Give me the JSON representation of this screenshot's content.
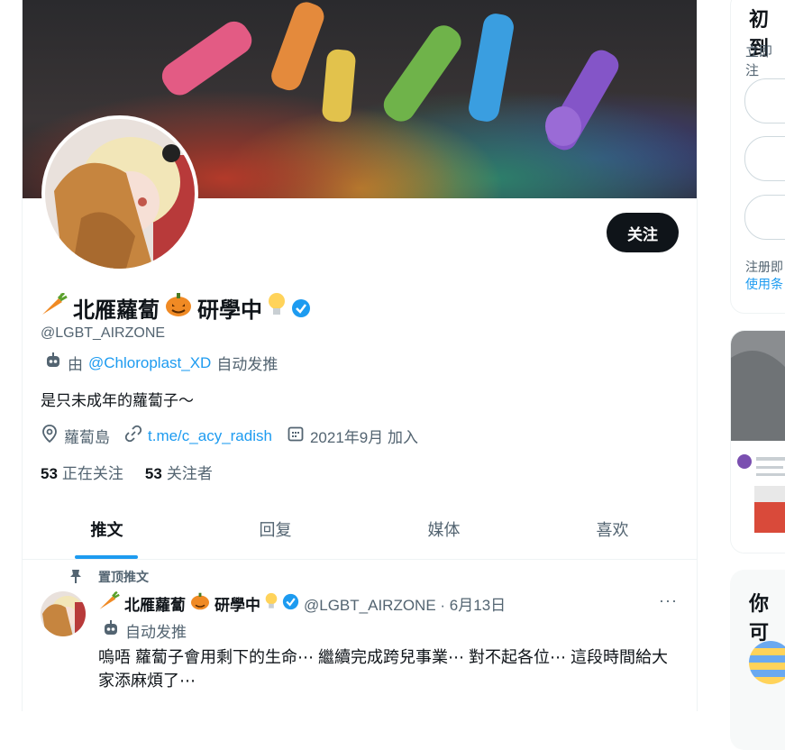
{
  "profile": {
    "display_name": "北雁蘿蔔",
    "name_suffix": "研學中",
    "handle": "@LGBT_AIRZONE",
    "automated_prefix": "由",
    "automated_account": "@Chloroplast_XD",
    "automated_suffix": "自动发推",
    "bio": "是只未成年的蘿蔔子～",
    "location": "蘿蔔島",
    "website": "t.me/c_acy_radish",
    "joined": "2021年9月 加入",
    "following_count": "53",
    "following_label": "正在关注",
    "followers_count": "53",
    "followers_label": "关注者",
    "follow_button": "关注"
  },
  "tabs": [
    {
      "label": "推文"
    },
    {
      "label": "回复"
    },
    {
      "label": "媒体"
    },
    {
      "label": "喜欢"
    }
  ],
  "pinned_tweet": {
    "pinned_label": "置顶推文",
    "display_name": "北雁蘿蔔",
    "name_suffix": "研學中",
    "handle_date": "@LGBT_AIRZONE · 6月13日",
    "automated": "自动发推",
    "text": "嗚唔 蘿蔔子會用剩下的生命⋯ 繼續完成跨兒事業⋯ 對不起各位⋯ 這段時間給大家添麻煩了⋯",
    "more": "···"
  },
  "sidebar": {
    "signup_title": "初到",
    "signup_sub": "立即注",
    "note_line1": "注册即",
    "note_line2": "使用条",
    "who_to_follow_title": "你可"
  },
  "colors": {
    "accent": "#1d9bf0",
    "text": "#0f1419",
    "muted": "#536471",
    "verified": "#1d9bf0"
  },
  "icons": [
    "carrot-icon",
    "pumpkin-icon",
    "lightbulb-icon",
    "verified-icon",
    "bot-icon",
    "location-icon",
    "link-icon",
    "calendar-icon",
    "pin-icon",
    "more-icon"
  ]
}
